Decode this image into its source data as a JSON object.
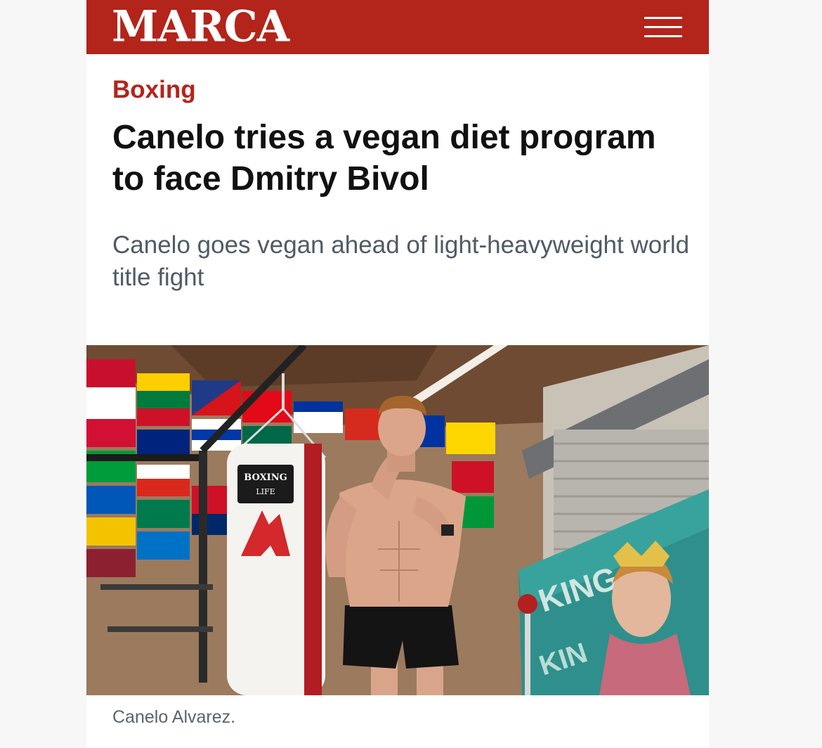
{
  "header": {
    "logo_text": "MARCA",
    "brand_color": "#b3241a",
    "menu_icon": "hamburger-menu-icon"
  },
  "article": {
    "section": "Boxing",
    "headline": "Canelo tries a vegan diet program to face Dmitry Bivol",
    "subheadline": "Canelo goes vegan ahead of light-heavyweight world title fight",
    "photo": {
      "alt": "Canelo Alvarez shadowboxing in a gym next to a heavy bag",
      "bag_text_line1": "BOXING",
      "bag_text_line2": "LIFE",
      "poster_text": "KING"
    },
    "caption": "Canelo Alvarez."
  }
}
